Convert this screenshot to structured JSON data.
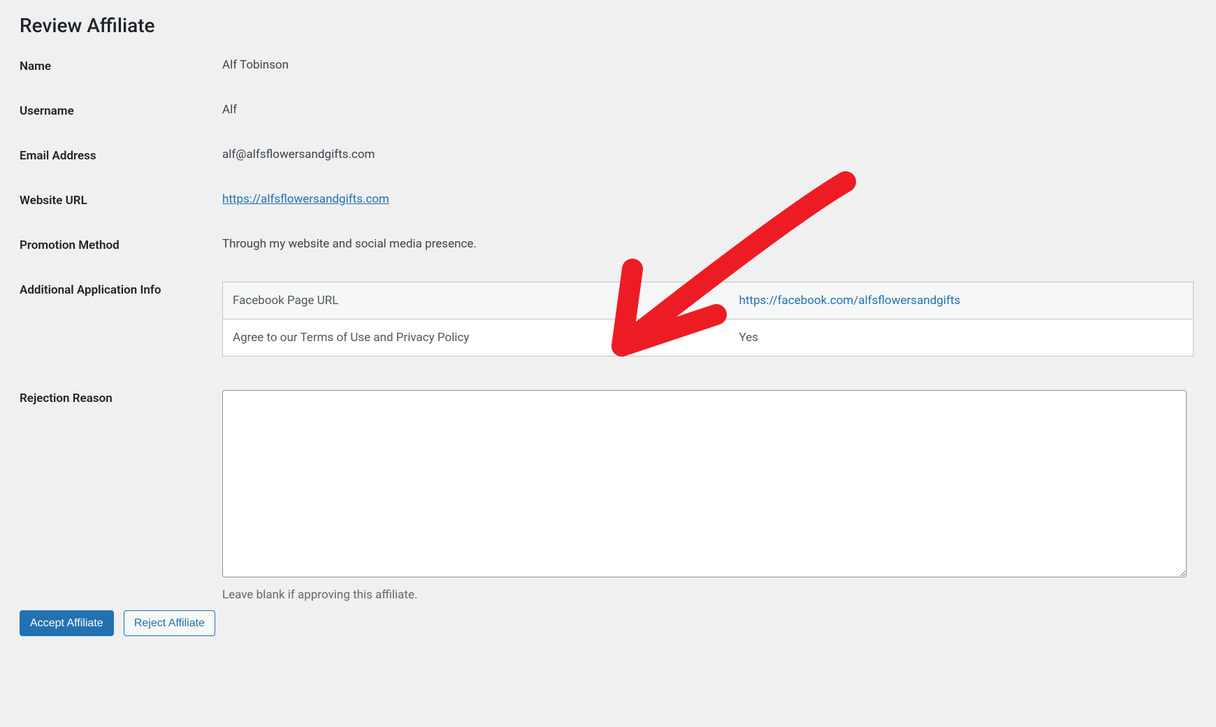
{
  "page": {
    "title": "Review Affiliate"
  },
  "fields": {
    "name_label": "Name",
    "name_value": "Alf Tobinson",
    "username_label": "Username",
    "username_value": "Alf",
    "email_label": "Email Address",
    "email_value": "alf@alfsflowersandgifts.com",
    "website_label": "Website URL",
    "website_value": "https://alfsflowersandgifts.com",
    "promotion_label": "Promotion Method",
    "promotion_value": "Through my website and social media presence.",
    "additional_label": "Additional Application Info",
    "rejection_label": "Rejection Reason",
    "rejection_hint": "Leave blank if approving this affiliate."
  },
  "additional_info": [
    {
      "key": "Facebook Page URL",
      "value": "https://facebook.com/alfsflowersandgifts",
      "link": true
    },
    {
      "key": "Agree to our Terms of Use and Privacy Policy",
      "value": "Yes",
      "link": false
    }
  ],
  "actions": {
    "accept_label": "Accept Affiliate",
    "reject_label": "Reject Affiliate"
  },
  "annotation": {
    "arrow_color": "#ed1c24"
  }
}
